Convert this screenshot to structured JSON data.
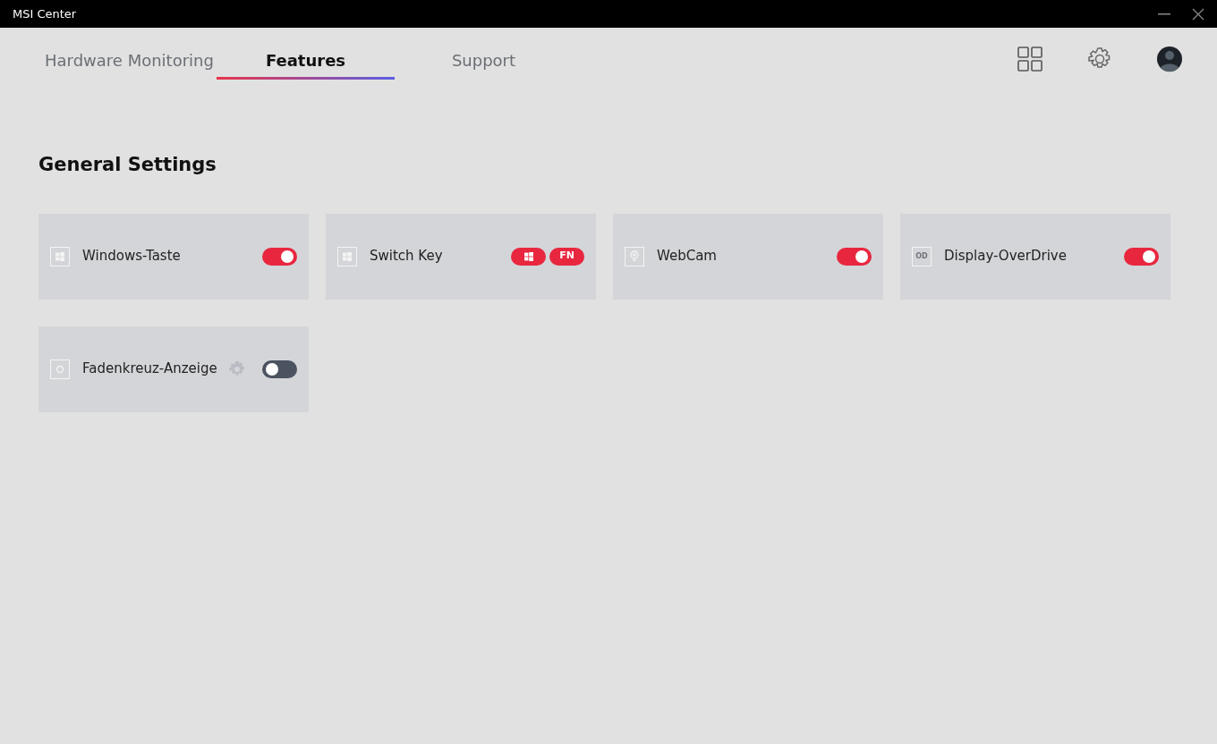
{
  "window": {
    "title": "MSI Center"
  },
  "tabs": [
    {
      "label": "Hardware Monitoring",
      "selected": false
    },
    {
      "label": "Features",
      "selected": true
    },
    {
      "label": "Support",
      "selected": false
    }
  ],
  "section_title": "General Settings",
  "features": [
    {
      "kind": "toggle",
      "label": "Windows-Taste",
      "on": true
    },
    {
      "kind": "switch-pair",
      "label": "Switch Key",
      "fn_label": "FN"
    },
    {
      "kind": "toggle",
      "label": "WebCam",
      "on": true
    },
    {
      "kind": "toggle",
      "icon_text": "OD",
      "label": "Display-OverDrive",
      "on": true
    },
    {
      "kind": "toggle-with-settings",
      "label": "Fadenkreuz-Anzeige",
      "on": false
    }
  ]
}
